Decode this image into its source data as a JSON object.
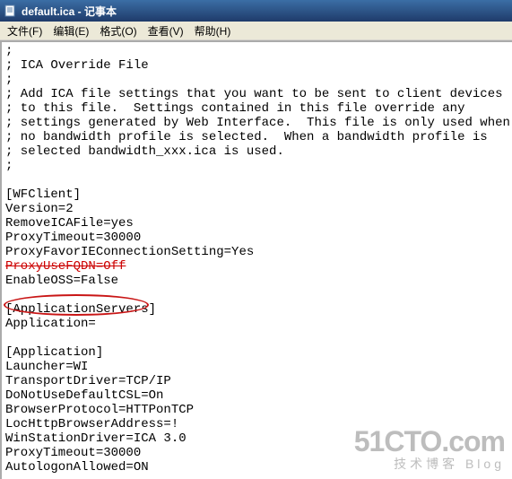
{
  "titlebar": {
    "title": "default.ica - 记事本"
  },
  "menubar": {
    "items": [
      "文件(F)",
      "编辑(E)",
      "格式(O)",
      "查看(V)",
      "帮助(H)"
    ]
  },
  "editor": {
    "lines": [
      ";",
      "; ICA Override File",
      ";",
      "; Add ICA file settings that you want to be sent to client devices",
      "; to this file.  Settings contained in this file override any",
      "; settings generated by Web Interface.  This file is only used when",
      "; no bandwidth profile is selected.  When a bandwidth profile is",
      "; selected bandwidth_xxx.ica is used.",
      ";",
      "",
      "[WFClient]",
      "Version=2",
      "RemoveICAFile=yes",
      "ProxyTimeout=30000",
      "ProxyFavorIEConnectionSetting=Yes",
      "ProxyUseFQDN=Off",
      "EnableOSS=False",
      "",
      "[ApplicationServers]",
      "Application=",
      "",
      "[Application]",
      "Launcher=WI",
      "TransportDriver=TCP/IP",
      "DoNotUseDefaultCSL=On",
      "BrowserProtocol=HTTPonTCP",
      "LocHttpBrowserAddress=!",
      "WinStationDriver=ICA 3.0",
      "ProxyTimeout=30000",
      "AutologonAllowed=ON"
    ],
    "strike_line_index": 15,
    "highlighted_line_index": 16
  },
  "watermark": {
    "main": "51CTO.com",
    "sub": "技术博客   Blog"
  }
}
